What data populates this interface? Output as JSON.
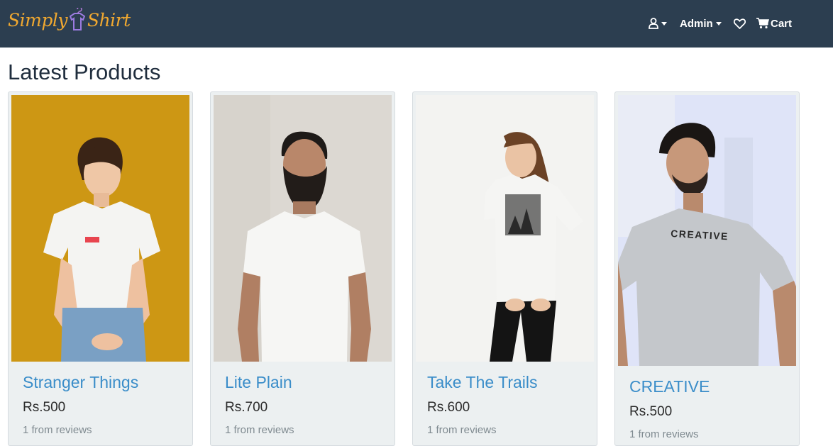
{
  "brand": {
    "name_part1": "Simply",
    "name_part2": "Shirt"
  },
  "nav": {
    "admin_label": "Admin",
    "cart_label": "Cart"
  },
  "page_title": "Latest Products",
  "products": [
    {
      "name": "Stranger Things",
      "price": "Rs.500",
      "reviews": "1 from reviews"
    },
    {
      "name": "Lite Plain",
      "price": "Rs.700",
      "reviews": "1 from reviews"
    },
    {
      "name": "Take The Trails",
      "price": "Rs.600",
      "reviews": "1 from reviews"
    },
    {
      "name": "CREATIVE",
      "price": "Rs.500",
      "reviews": "1 from reviews"
    }
  ],
  "colors": {
    "navbar": "#2c3e50",
    "brand": "#f0a830",
    "link": "#3a8dc9"
  }
}
